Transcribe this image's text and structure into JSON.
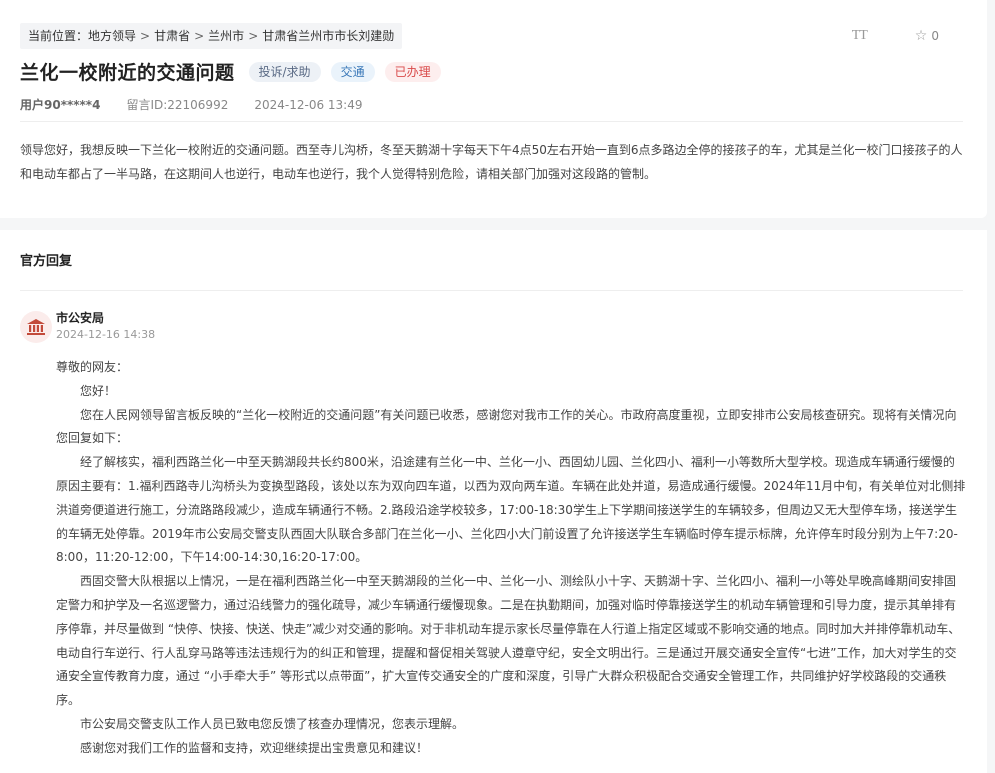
{
  "breadcrumb": {
    "prefix": "当前位置：",
    "items": [
      "地方领导",
      "甘肃省",
      "兰州市",
      "甘肃省兰州市市长刘建勋"
    ]
  },
  "tools": {
    "font_label": "TT",
    "fav_count": "0"
  },
  "message": {
    "title": "兰化一校附近的交通问题",
    "tags": [
      "投诉/求助",
      "交通",
      "已办理"
    ],
    "user": "用户90*****4",
    "id_label": "留言ID:22106992",
    "datetime": "2024-12-06 13:49",
    "content": "领导您好，我想反映一下兰化一校附近的交通问题。西至寺儿沟桥，冬至天鹅湖十字每天下午4点50左右开始一直到6点多路边全停的接孩子的车，尤其是兰化一校门口接孩子的人和电动车都占了一半马路，在这期间人也逆行，电动车也逆行，我个人觉得特别危险，请相关部门加强对这段路的管制。"
  },
  "reply": {
    "section_title": "官方回复",
    "org": "市公安局",
    "time": "2024-12-16 14:38",
    "greeting": "尊敬的网友：",
    "paragraphs": [
      "您好！",
      "您在人民网领导留言板反映的“兰化一校附近的交通问题”有关问题已收悉，感谢您对我市工作的关心。市政府高度重视，立即安排市公安局核查研究。现将有关情况向您回复如下：",
      "经了解核实，福利西路兰化一中至天鹅湖段共长约800米，沿途建有兰化一中、兰化一小、西固幼儿园、兰化四小、福利一小等数所大型学校。现造成车辆通行缓慢的原因主要有：1.福利西路寺儿沟桥头为变换型路段，该处以东为双向四车道，以西为双向两车道。车辆在此处并道，易造成通行缓慢。2024年11月中旬，有关单位对北侧排洪道旁便道进行施工，分流路路段减少，造成车辆通行不畅。2.路段沿途学校较多，17:00-18:30学生上下学期间接送学生的车辆较多，但周边又无大型停车场，接送学生的车辆无处停靠。2019年市公安局交警支队西固大队联合多部门在兰化一小、兰化四小大门前设置了允许接送学生车辆临时停车提示标牌，允许停车时段分别为上午7:20-8:00，11:20-12:00，下午14:00-14:30,16:20-17:00。",
      "西固交警大队根据以上情况，一是在福利西路兰化一中至天鹅湖段的兰化一中、兰化一小、测绘队小十字、天鹅湖十字、兰化四小、福利一小等处早晚高峰期间安排固定警力和护学及一名巡逻警力，通过沿线警力的强化疏导，减少车辆通行缓慢现象。二是在执勤期间，加强对临时停靠接送学生的机动车辆管理和引导力度，提示其单排有序停靠，并尽量做到 “快停、快接、快送、快走”减少对交通的影响。对于非机动车提示家长尽量停靠在人行道上指定区域或不影响交通的地点。同时加大并排停靠机动车、电动自行车逆行、行人乱穿马路等违法违规行为的纠正和管理，提醒和督促相关驾驶人遵章守纪，安全文明出行。三是通过开展交通安全宣传“七进”工作，加大对学生的交通安全宣传教育力度，通过 “小手牵大手” 等形式以点带面”，扩大宣传交通安全的广度和深度，引导广大群众积极配合交通安全管理工作，共同维护好学校路段的交通秩序。",
      "市公安局交警支队工作人员已致电您反馈了核查办理情况，您表示理解。",
      "感谢您对我们工作的监督和支持，欢迎继续提出宝贵意见和建议！"
    ]
  },
  "icons": {
    "org_icon": "building-icon",
    "fav_icon": "star-icon",
    "font_icon": "font-size-icon"
  },
  "colors": {
    "tag_done": "#d94b4b",
    "tag_traffic": "#3a78b8",
    "tag_type": "#5a6a85",
    "avatar_bg": "#fbeceb"
  }
}
